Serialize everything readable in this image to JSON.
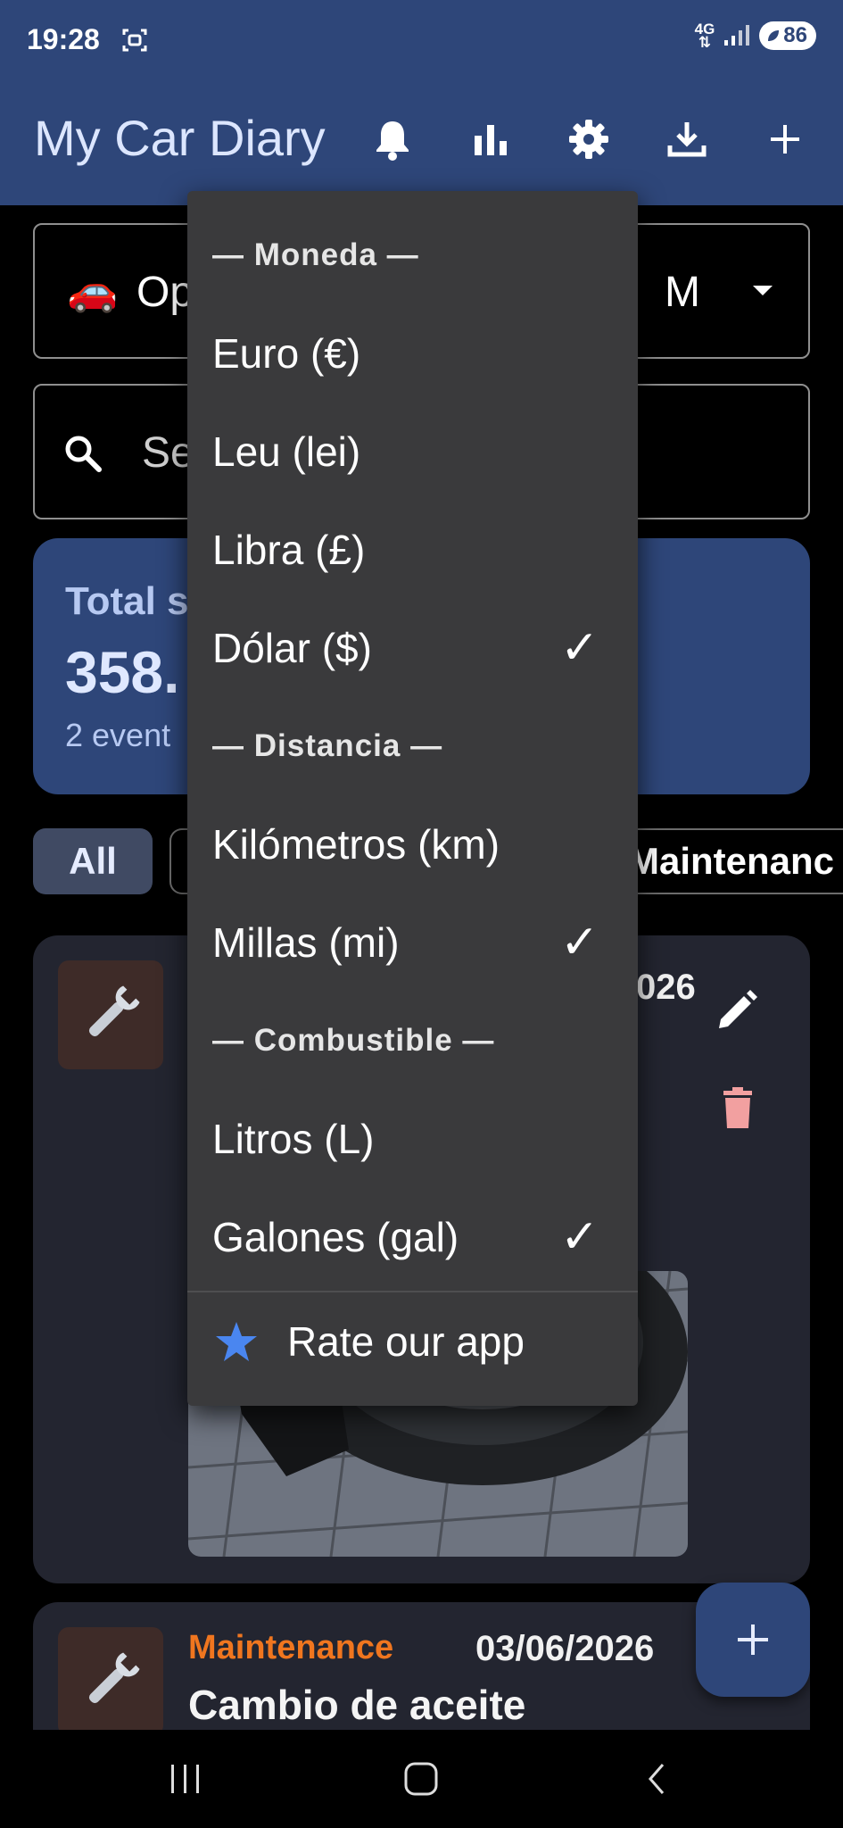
{
  "status_bar": {
    "time": "19:28",
    "network": "4G",
    "battery": "86"
  },
  "app_bar": {
    "title": "My Car Diary"
  },
  "vehicle_select": {
    "emoji": "🚗",
    "value_visible": "Op",
    "value_tail": "M"
  },
  "search": {
    "placeholder_visible": "Se"
  },
  "summary": {
    "label_visible": "Total s",
    "value_visible": "358.",
    "events_visible": "2 event"
  },
  "filters": {
    "all": "All",
    "maintenance_visible": "Maintenanc"
  },
  "events": [
    {
      "date_visible": "026"
    },
    {
      "category": "Maintenance",
      "date": "03/06/2026",
      "title": "Cambio de aceite"
    }
  ],
  "menu": {
    "currency_header": "— Moneda —",
    "currency_items": [
      {
        "label": "Euro (€)",
        "checked": false
      },
      {
        "label": "Leu (lei)",
        "checked": false
      },
      {
        "label": "Libra (£)",
        "checked": false
      },
      {
        "label": "Dólar ($)",
        "checked": true
      }
    ],
    "distance_header": "— Distancia —",
    "distance_items": [
      {
        "label": "Kilómetros (km)",
        "checked": false
      },
      {
        "label": "Millas (mi)",
        "checked": true
      }
    ],
    "fuel_header": "— Combustible —",
    "fuel_items": [
      {
        "label": "Litros (L)",
        "checked": false
      },
      {
        "label": "Galones (gal)",
        "checked": true
      }
    ],
    "check_glyph": "✓",
    "rate_label": "Rate our app"
  },
  "colors": {
    "app_bar": "#2e4679",
    "menu_bg": "#3a3a3c",
    "category_orange": "#f0761f",
    "delete_pink": "#f2a0a0",
    "star_blue": "#4a86f0"
  },
  "icons": [
    "screenshot-icon",
    "signal-icon",
    "bell-icon",
    "bar-chart-icon",
    "gear-icon",
    "download-icon",
    "plus-icon",
    "search-icon",
    "wrench-icon",
    "edit-icon",
    "delete-icon",
    "star-icon",
    "nav-recents-icon",
    "nav-home-icon",
    "nav-back-icon"
  ]
}
